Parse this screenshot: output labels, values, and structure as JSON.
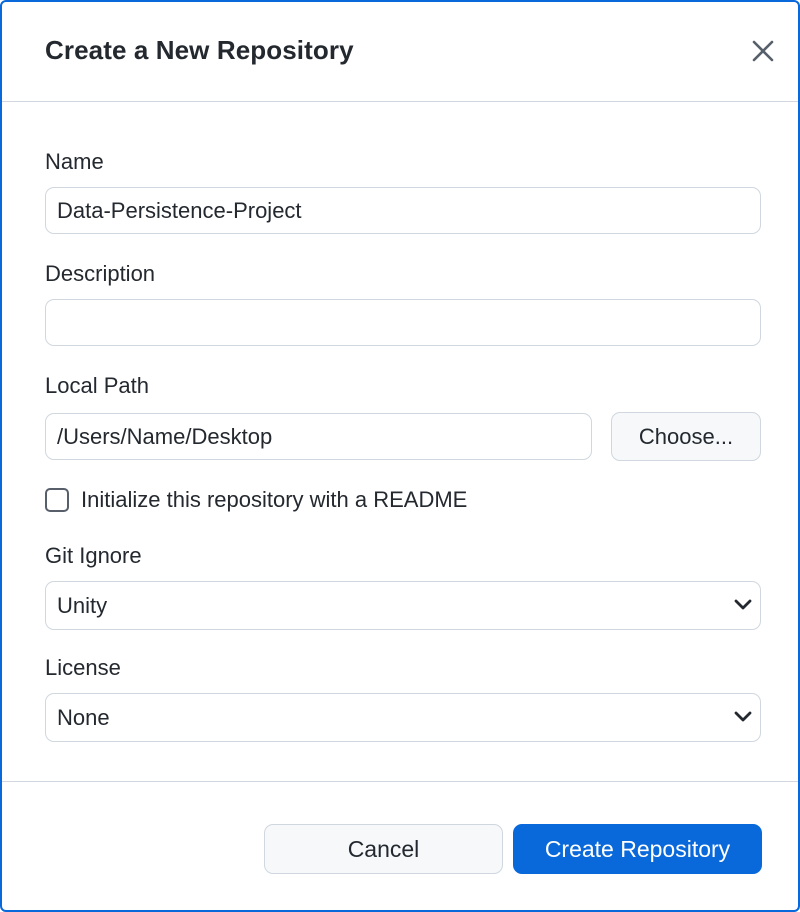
{
  "dialog": {
    "title": "Create a New Repository",
    "close_icon": "close-icon"
  },
  "form": {
    "name": {
      "label": "Name",
      "value": "Data-Persistence-Project"
    },
    "description": {
      "label": "Description",
      "value": ""
    },
    "local_path": {
      "label": "Local Path",
      "value": "/Users/Name/Desktop",
      "choose_label": "Choose..."
    },
    "readme": {
      "label": "Initialize this repository with a README",
      "checked": false
    },
    "git_ignore": {
      "label": "Git Ignore",
      "selected": "Unity",
      "icon": "chevron-down-icon"
    },
    "license": {
      "label": "License",
      "selected": "None",
      "icon": "chevron-down-icon"
    }
  },
  "footer": {
    "cancel_label": "Cancel",
    "create_label": "Create Repository"
  },
  "colors": {
    "accent": "#0969da",
    "border": "#d0d7de",
    "text": "#24292f",
    "button_bg": "#f6f8fa"
  }
}
